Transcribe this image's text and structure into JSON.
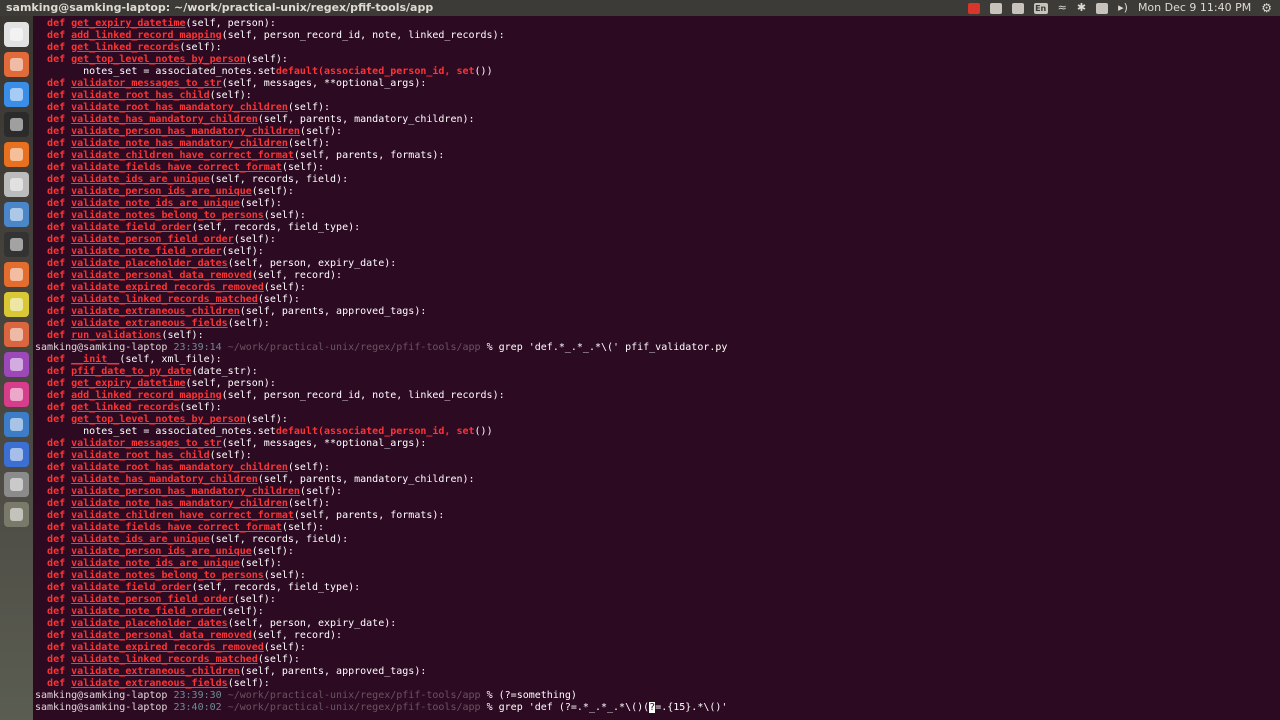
{
  "window_title": "samking@samking-laptop: ~/work/practical-unix/regex/pfif-tools/app",
  "tray": {
    "icons": [
      "record-icon",
      "mail-icon",
      "window-icon",
      "keyboard-lang-icon",
      "wifi-icon",
      "bluetooth-icon",
      "message-icon",
      "volume-icon"
    ],
    "language": "En",
    "clock": "Mon Dec 9  11:40 PM",
    "accent": "#d9362b"
  },
  "launcher": {
    "items": [
      {
        "icon": "dash-home-icon",
        "color": "#e2e2e2"
      },
      {
        "icon": "files-icon",
        "color": "#e06a3a"
      },
      {
        "icon": "chrome-icon",
        "color": "#3a8ee8"
      },
      {
        "icon": "terminal-icon",
        "color": "#2b2b2b"
      },
      {
        "icon": "firefox-icon",
        "color": "#e8711f"
      },
      {
        "icon": "drive-icon",
        "color": "#bcbcbc"
      },
      {
        "icon": "text-editor-icon",
        "color": "#4a86c8"
      },
      {
        "icon": "system-monitor-icon",
        "color": "#333333"
      },
      {
        "icon": "software-center-icon",
        "color": "#e36d2f"
      },
      {
        "icon": "sticky-notes-icon",
        "color": "#d8c835"
      },
      {
        "icon": "bag-icon",
        "color": "#d9663e"
      },
      {
        "icon": "purple-app-icon",
        "color": "#9c48b8"
      },
      {
        "icon": "pink-app-icon",
        "color": "#d63e8c"
      },
      {
        "icon": "update-manager-icon",
        "color": "#3d7cc7"
      },
      {
        "icon": "video-player-icon",
        "color": "#3b6fd1"
      },
      {
        "icon": "workspace-icon",
        "color": "#8b8b8b"
      },
      {
        "icon": "trash-icon",
        "color": "#7a7a6a"
      }
    ]
  },
  "prompt": {
    "user": "samking@samking-laptop",
    "path": "~/work/practical-unix/regex/pfif-tools/app",
    "symbol": "%"
  },
  "defs_a": [
    [
      "get_expiry_datetime",
      "(self, person):"
    ],
    [
      "add_linked_record_mapping",
      "(self, person_record_id, note, linked_records):"
    ],
    [
      "get_linked_records",
      "(self):"
    ],
    [
      "get_top_level_notes_by_person",
      "(self):"
    ]
  ],
  "note_line": {
    "before": "        notes_set = associated_notes.set",
    "func": "default",
    "args": "(associated_person_id, set",
    "after": "())"
  },
  "defs_b": [
    [
      "validator_messages_to_str",
      "(self, messages, **optional_args):"
    ],
    [
      "validate_root_has_child",
      "(self):"
    ],
    [
      "validate_root_has_mandatory_children",
      "(self):"
    ],
    [
      "validate_has_mandatory_children",
      "(self, parents, mandatory_children):"
    ],
    [
      "validate_person_has_mandatory_children",
      "(self):"
    ],
    [
      "validate_note_has_mandatory_children",
      "(self):"
    ],
    [
      "validate_children_have_correct_format",
      "(self, parents, formats):"
    ],
    [
      "validate_fields_have_correct_format",
      "(self):"
    ],
    [
      "validate_ids_are_unique",
      "(self, records, field):"
    ],
    [
      "validate_person_ids_are_unique",
      "(self):"
    ],
    [
      "validate_note_ids_are_unique",
      "(self):"
    ],
    [
      "validate_notes_belong_to_persons",
      "(self):"
    ],
    [
      "validate_field_order",
      "(self, records, field_type):"
    ],
    [
      "validate_person_field_order",
      "(self):"
    ],
    [
      "validate_note_field_order",
      "(self):"
    ],
    [
      "validate_placeholder_dates",
      "(self, person, expiry_date):"
    ],
    [
      "validate_personal_data_removed",
      "(self, record):"
    ],
    [
      "validate_expired_records_removed",
      "(self):"
    ],
    [
      "validate_linked_records_matched",
      "(self):"
    ],
    [
      "validate_extraneous_children",
      "(self, parents, approved_tags):"
    ]
  ],
  "first_tail": [
    [
      "validate_extraneous_fields",
      "(self):"
    ],
    [
      "run_validations",
      "(self):"
    ]
  ],
  "second_head": [
    [
      "__init__",
      "(self, xml_file):"
    ],
    [
      "pfif_date_to_py_date",
      "(date_str):"
    ]
  ],
  "second_tail": [
    [
      "validate_extraneous_fields",
      "(self):"
    ]
  ],
  "commands": [
    {
      "time": "23:39:14",
      "text": "grep 'def.*_.*_.*\\(' pfif_validator.py"
    },
    {
      "time": "23:39:30",
      "text": "(?=something)"
    },
    {
      "time": "23:40:02",
      "before": "grep 'def (?=.*_.*_.*\\()(",
      "cursor": "?",
      "after": "=.{15}.*\\()'"
    }
  ]
}
